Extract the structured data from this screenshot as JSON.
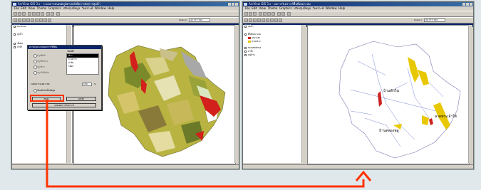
{
  "left_window": {
    "title": "ArcView GIS 3.x - ระบบสารสนเทศภูมิศาสตร์เพื่อการจัดการลุ่มน้ำ",
    "menu": [
      "File",
      "Edit",
      "View",
      "Theme",
      "Graphics",
      "ปรับปรุงข้อมูล",
      "วิเคราะห์",
      "Window",
      "Help"
    ],
    "scale_label": "Scale 1:",
    "scale_value": "42,777,700",
    "toc_title": "View1",
    "toc_items": [
      "Landuse",
      "ลุ่มน้ำ",
      "ชั้นดิน",
      "ลำน้ำ"
    ],
    "dialog": {
      "title": "ความเหมาะสมของการใช้ที่ดิน",
      "list_header": "ชนิดพืช",
      "list_items": [
        "ข้าว",
        "ยางพารา",
        "ปาล์ม",
        "ไม้ผล"
      ],
      "selected_index": 0,
      "options": [
        "ปลูกพืชไร่",
        "ปลูกพืชสวน",
        "ปลูกข้าว",
        "ปลูกไม้ยืนต้น"
      ],
      "threshold_label": "ระดับความเหมาะสม",
      "threshold_value": "100",
      "threshold_unit": "%",
      "checkbox_label": "ซ้อนทับกับชั้นข้อมูล",
      "button_ok": "ตกลง",
      "button_cancel": "ยกเลิก",
      "button_show": "แสดงผลการวิเคราะห์"
    }
  },
  "right_window": {
    "title": "ArcView GIS 3.x - ผลการวิเคราะห์พื้นที่เหมาะสม",
    "menu": [
      "File",
      "Edit",
      "View",
      "Theme",
      "Graphics",
      "ปรับปรุงข้อมูล",
      "วิเคราะห์",
      "Window",
      "Help"
    ],
    "scale_label": "Scale 1:",
    "scale_value": "42,777,700",
    "toc_title": "View2",
    "toc_items": [
      "ลุ่มน้ำ",
      "พื้นที่เหมาะสม",
      "ขอบเขตตำบล",
      "ลำน้ำ",
      "หมู่บ้าน"
    ],
    "legend": [
      {
        "label": "เหมาะสม",
        "color": "#cc2222"
      },
      {
        "label": "ปานกลาง",
        "color": "#e8c800"
      }
    ],
    "map_labels": [
      "บ้านพักวิน",
      "บ้านคลองพลู",
      "ลาดพระเจ้าใต้"
    ]
  },
  "colors": {
    "background": "#e1e8ec",
    "arrow": "#ff3300",
    "title_bar": "#0a246a",
    "suitable_red": "#cc2222",
    "moderate_yellow": "#e8c800"
  }
}
